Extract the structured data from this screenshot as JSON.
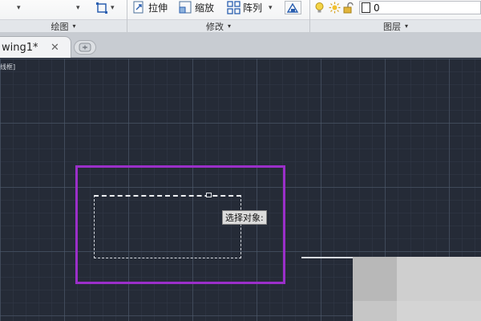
{
  "ribbon": {
    "modify": {
      "stretch_label": "拉伸",
      "scale_label": "缩放",
      "array_label": "阵列",
      "panel_title": "修改"
    },
    "draw": {
      "panel_title": "绘图"
    },
    "layers": {
      "panel_title": "图层",
      "current_layer": "0"
    }
  },
  "tabs": [
    {
      "label": "wing1*"
    }
  ],
  "canvas": {
    "viewport_label": "线框]",
    "command_prompt": "选择对象:",
    "colors": {
      "background": "#252b37",
      "rectangle": "#9b2fc9"
    }
  }
}
